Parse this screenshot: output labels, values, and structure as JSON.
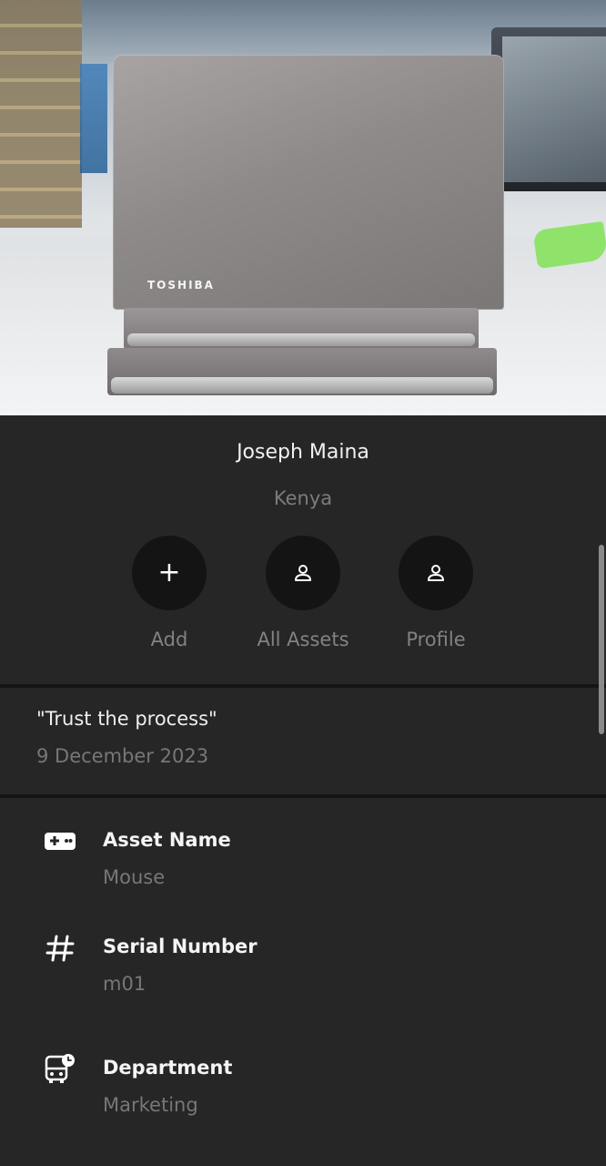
{
  "hero": {
    "brand_text": "TOSHIBA"
  },
  "profile": {
    "name": "Joseph Maina",
    "country": "Kenya",
    "actions": [
      {
        "label": "Add",
        "icon": "plus-icon"
      },
      {
        "label": "All Assets",
        "icon": "person-icon"
      },
      {
        "label": "Profile",
        "icon": "person-icon"
      }
    ]
  },
  "quote": {
    "text": "\"Trust the process\"",
    "date": "9 December 2023"
  },
  "details": [
    {
      "title": "Asset Name",
      "value": "Mouse",
      "icon": "gamepad-icon"
    },
    {
      "title": "Serial Number",
      "value": "m01",
      "icon": "hash-icon"
    },
    {
      "title": "Department",
      "value": "Marketing",
      "icon": "bus-clock-icon"
    }
  ],
  "colors": {
    "background": "#262626",
    "button_circle": "#141414",
    "primary_text": "#f1f1f1",
    "secondary_text": "#7c7c7c"
  }
}
